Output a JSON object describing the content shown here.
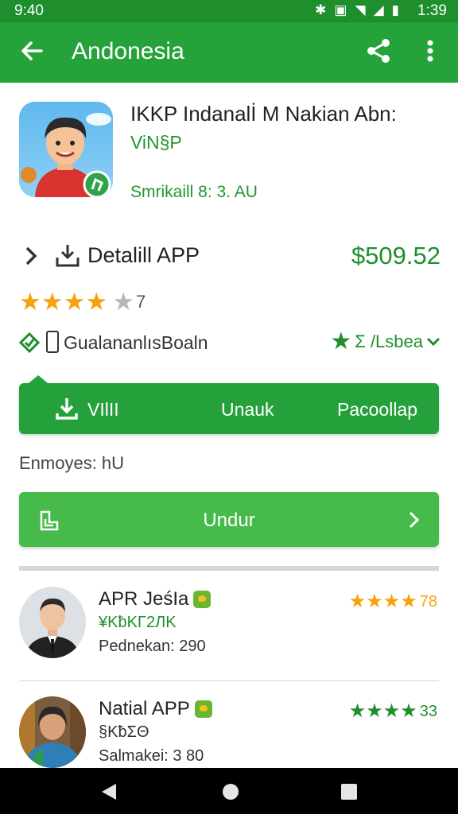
{
  "status_bar": {
    "time": "9:40",
    "clock": "1:39",
    "icons": [
      "bluetooth-icon",
      "battery-saver-icon",
      "wifi-icon",
      "signal-icon",
      "battery-icon"
    ]
  },
  "app_bar": {
    "title": "Andonesia"
  },
  "app": {
    "name": "IKKP Indanalİ M Nakian Abn:",
    "developer": "ViN§P",
    "size": "Smrikaill 8: 3. AU"
  },
  "detail": {
    "label": "Detalill APP",
    "price": "$509.52"
  },
  "rating": {
    "count": "7",
    "stars_filled": 4,
    "stars_total": 5
  },
  "category": {
    "label": "GualananlısBoaln",
    "right_label": "Σ /Lsbea"
  },
  "actions": {
    "install": "VIlII",
    "unlock": "Unauk",
    "pascollap": "Pacoollap"
  },
  "employees": "Enmoyes: hU",
  "download": {
    "label": "Undur"
  },
  "colors": {
    "primary": "#25a23a",
    "status": "#1f8f2d",
    "button": "#46bb4c",
    "star": "#f5a20d",
    "price": "#1f8f2d"
  },
  "list": [
    {
      "name": "APR JeśIa",
      "subtitle": "¥KƀKΓ2ЛK",
      "meta": "Pednekan: 290",
      "rating": "78",
      "star_color": "#f5a20d"
    },
    {
      "name": "Natial APP",
      "subtitle": "§KƀΣΘ",
      "meta": "Salmakei: 3 80",
      "rating": "33",
      "star_color": "#1f8f2d"
    }
  ]
}
